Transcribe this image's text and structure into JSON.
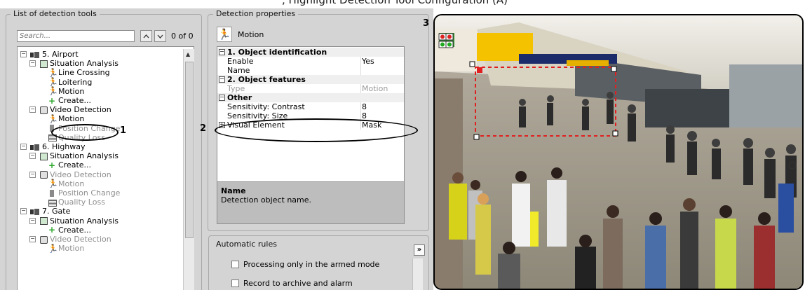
{
  "top_caption": ", Highlight Detection Tool Configuration (A)",
  "left_panel": {
    "group_title": "List of detection tools",
    "search": {
      "placeholder": "Search...",
      "count": "0 of 0"
    },
    "tree": [
      {
        "label": "5. Airport",
        "icon": "server-icon",
        "level": 0,
        "expander": "−",
        "dim": false
      },
      {
        "label": "Situation Analysis",
        "icon": "situation-analysis-icon",
        "level": 1,
        "expander": "−",
        "dim": false
      },
      {
        "label": "Line Crossing",
        "icon": "line-crossing-icon",
        "level": 2,
        "dim": false
      },
      {
        "label": "Loitering",
        "icon": "loitering-icon",
        "level": 2,
        "dim": false
      },
      {
        "label": "Motion",
        "icon": "motion-icon",
        "level": 2,
        "dim": false
      },
      {
        "label": "Create...",
        "icon": "create-icon",
        "level": 2,
        "dim": false
      },
      {
        "label": "Video Detection",
        "icon": "video-detection-icon",
        "level": 1,
        "expander": "−",
        "dim": false
      },
      {
        "label": "Motion",
        "icon": "motion-icon",
        "level": 2,
        "dim": false
      },
      {
        "label": "Position Change",
        "icon": "position-change-icon",
        "level": 2,
        "dim": true
      },
      {
        "label": "Quality Loss",
        "icon": "quality-loss-icon",
        "level": 2,
        "dim": true
      },
      {
        "label": "6. Highway",
        "icon": "server-icon",
        "level": 0,
        "expander": "−",
        "dim": false
      },
      {
        "label": "Situation Analysis",
        "icon": "situation-analysis-icon",
        "level": 1,
        "expander": "−",
        "dim": false
      },
      {
        "label": "Create...",
        "icon": "create-icon",
        "level": 2,
        "dim": false
      },
      {
        "label": "Video Detection",
        "icon": "video-detection-icon",
        "level": 1,
        "expander": "−",
        "dim": true
      },
      {
        "label": "Motion",
        "icon": "motion-icon",
        "level": 2,
        "dim": true
      },
      {
        "label": "Position Change",
        "icon": "position-change-icon",
        "level": 2,
        "dim": true
      },
      {
        "label": "Quality Loss",
        "icon": "quality-loss-icon",
        "level": 2,
        "dim": true
      },
      {
        "label": "7. Gate",
        "icon": "server-icon",
        "level": 0,
        "expander": "−",
        "dim": false
      },
      {
        "label": "Situation Analysis",
        "icon": "situation-analysis-icon",
        "level": 1,
        "expander": "−",
        "dim": false
      },
      {
        "label": "Create...",
        "icon": "create-icon",
        "level": 2,
        "dim": false
      },
      {
        "label": "Video Detection",
        "icon": "video-detection-icon",
        "level": 1,
        "expander": "−",
        "dim": true
      },
      {
        "label": "Motion",
        "icon": "motion-icon",
        "level": 2,
        "dim": true
      }
    ]
  },
  "props_panel": {
    "group_title": "Detection properties",
    "header_title": "Motion",
    "rows": [
      {
        "type": "category",
        "toggle": "−",
        "key": "1. Object identification",
        "value": ""
      },
      {
        "type": "row",
        "key": "Enable",
        "value": "Yes"
      },
      {
        "type": "row",
        "key": "Name",
        "value": ""
      },
      {
        "type": "category",
        "toggle": "−",
        "key": "2. Object features",
        "value": ""
      },
      {
        "type": "row",
        "key": "Type",
        "value": "Motion",
        "dim": true
      },
      {
        "type": "category",
        "toggle": "−",
        "key": "Other",
        "value": ""
      },
      {
        "type": "row",
        "key": "Sensitivity: Contrast",
        "value": "8"
      },
      {
        "type": "row",
        "key": "Sensitivity: Size",
        "value": "8"
      },
      {
        "type": "row",
        "toggle": "+",
        "key": "Visual Element",
        "value": "Mask"
      }
    ],
    "description": {
      "title": "Name",
      "text": "Detection object name."
    }
  },
  "auto_rules": {
    "group_title": "Automatic rules",
    "items": [
      "Processing only in the armed mode",
      "Record to archive and alarm"
    ],
    "collapse_label": "»"
  },
  "annotations": {
    "one": "1",
    "two": "2",
    "three": "3"
  },
  "colors": {
    "panel_bg": "#d4d4d4",
    "zone_dash": "#e02020"
  }
}
